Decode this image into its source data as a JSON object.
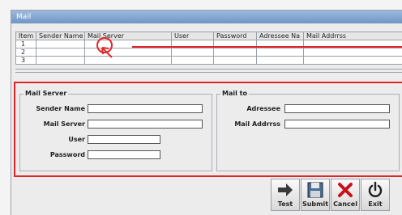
{
  "window": {
    "title": "Mail"
  },
  "grid": {
    "columns": [
      "Item",
      "Sender Name",
      "Mail Server",
      "User",
      "Password",
      "Adressee Na",
      "Mail Addrrss"
    ],
    "rows": [
      [
        "1",
        "",
        "",
        "",
        "",
        "",
        ""
      ],
      [
        "2",
        "",
        "",
        "",
        "",
        "",
        ""
      ],
      [
        "3",
        "",
        "",
        "",
        "",
        "",
        ""
      ]
    ]
  },
  "mail_server": {
    "title": "Mail Server",
    "sender_name_label": "Sender Name",
    "mail_server_label": "Mail Server",
    "user_label": "User",
    "password_label": "Password",
    "sender_name_value": "",
    "mail_server_value": "",
    "user_value": "",
    "password_value": ""
  },
  "mail_to": {
    "title": "Mail to",
    "adressee_label": "Adressee",
    "mail_address_label": "Mail Addrrss",
    "adressee_value": "",
    "mail_address_value": ""
  },
  "toolbar": {
    "test_label": "Test",
    "submit_label": "Submit",
    "cancel_label": "Cancel",
    "exit_label": "Exit"
  },
  "icons": {
    "test": "arrow-right-icon",
    "submit": "floppy-disk-icon",
    "cancel": "x-icon",
    "exit": "power-icon"
  },
  "colors": {
    "annotation": "#e0262b",
    "titlebar": "#7fa0cf"
  }
}
